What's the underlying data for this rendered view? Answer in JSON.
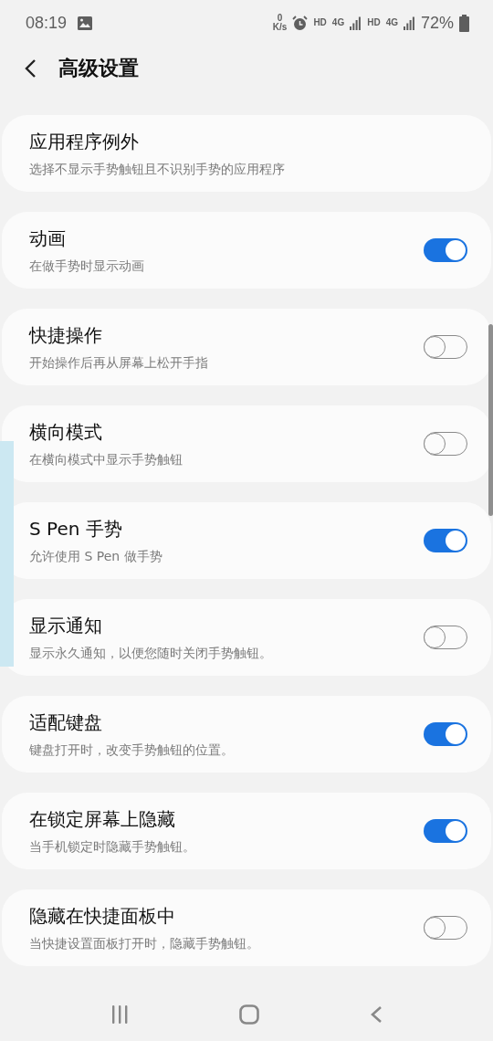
{
  "status_bar": {
    "time": "08:19",
    "net_speed_value": "0",
    "net_speed_unit": "K/s",
    "network": [
      {
        "hd": "HD",
        "gen": "4G"
      },
      {
        "hd": "HD",
        "gen": "4G"
      }
    ],
    "battery": "72%"
  },
  "header": {
    "title": "高级设置"
  },
  "items": [
    {
      "kind": "link",
      "title": "应用程序例外",
      "subtitle": "选择不显示手势触钮且不识别手势的应用程序"
    },
    {
      "kind": "switch",
      "title": "动画",
      "subtitle": "在做手势时显示动画",
      "on": true
    },
    {
      "kind": "switch",
      "title": "快捷操作",
      "subtitle": "开始操作后再从屏幕上松开手指",
      "on": false
    },
    {
      "kind": "switch",
      "title": "横向模式",
      "subtitle": "在横向模式中显示手势触钮",
      "on": false
    },
    {
      "kind": "switch",
      "title": "S Pen 手势",
      "subtitle": "允许使用 S Pen 做手势",
      "on": true
    },
    {
      "kind": "switch",
      "title": "显示通知",
      "subtitle": "显示永久通知，以便您随时关闭手势触钮。",
      "on": false
    },
    {
      "kind": "switch",
      "title": "适配键盘",
      "subtitle": "键盘打开时，改变手势触钮的位置。",
      "on": true
    },
    {
      "kind": "switch",
      "title": "在锁定屏幕上隐藏",
      "subtitle": "当手机锁定时隐藏手势触钮。",
      "on": true
    },
    {
      "kind": "switch",
      "title": "隐藏在快捷面板中",
      "subtitle": "当快捷设置面板打开时，隐藏手势触钮。",
      "on": false
    }
  ]
}
